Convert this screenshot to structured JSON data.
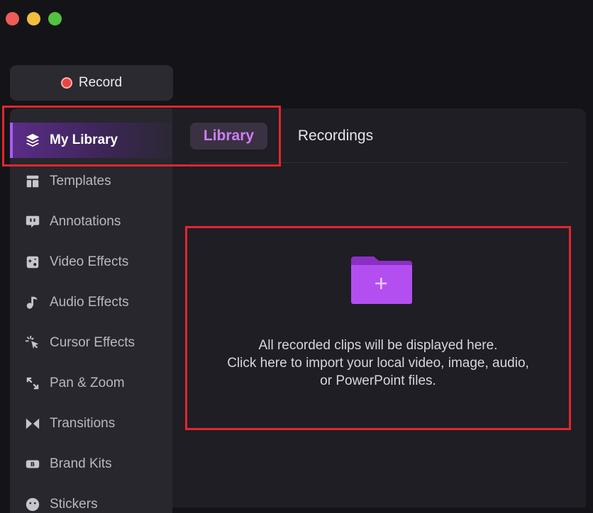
{
  "window": {
    "controls": [
      "close",
      "minimize",
      "maximize"
    ]
  },
  "record_button": {
    "label": "Record",
    "dot_color": "#f0433f"
  },
  "sidebar": {
    "items": [
      {
        "label": "My Library",
        "icon": "layers-icon",
        "active": true
      },
      {
        "label": "Templates",
        "icon": "template-icon",
        "active": false
      },
      {
        "label": "Annotations",
        "icon": "speech-bubble-icon",
        "active": false
      },
      {
        "label": "Video Effects",
        "icon": "video-effects-icon",
        "active": false
      },
      {
        "label": "Audio Effects",
        "icon": "music-note-icon",
        "active": false
      },
      {
        "label": "Cursor Effects",
        "icon": "cursor-click-icon",
        "active": false
      },
      {
        "label": "Pan & Zoom",
        "icon": "pan-zoom-icon",
        "active": false
      },
      {
        "label": "Transitions",
        "icon": "transition-icon",
        "active": false
      },
      {
        "label": "Brand Kits",
        "icon": "brand-kit-icon",
        "active": false
      },
      {
        "label": "Stickers",
        "icon": "sticker-icon",
        "active": false
      }
    ]
  },
  "main": {
    "tabs": [
      {
        "label": "Library",
        "active": true
      },
      {
        "label": "Recordings",
        "active": false
      }
    ],
    "dropzone": {
      "icon": "folder-plus-icon",
      "lines": [
        "All recorded clips will be displayed here.",
        "Click here to import your local video, image, audio,",
        "or PowerPoint files."
      ]
    }
  },
  "colors": {
    "accent": "#a45ff0",
    "active_tab_text": "#cf7df7",
    "highlight": "#e4262c",
    "folder": "#b34ff0"
  }
}
